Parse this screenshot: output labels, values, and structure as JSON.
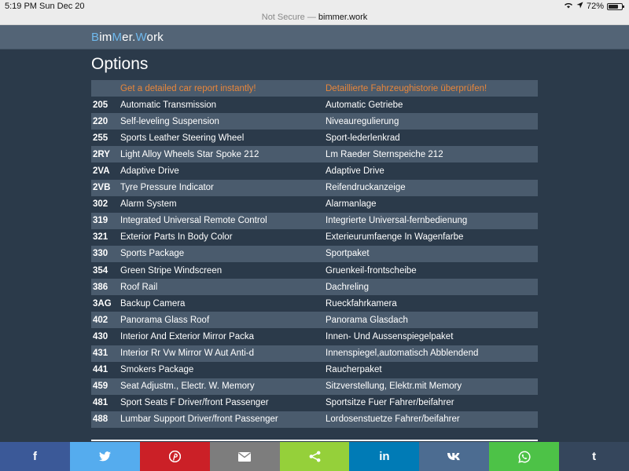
{
  "status_bar": {
    "time": "5:19 PM",
    "date": "Sun Dec 20",
    "battery": "72%",
    "battery_level": 0.72
  },
  "browser": {
    "security": "Not Secure —",
    "domain": "bimmer.work"
  },
  "site": {
    "logo_parts": [
      "B",
      "im",
      "M",
      "er.",
      "W",
      "ork"
    ]
  },
  "page": {
    "title": "Options"
  },
  "table": {
    "header": {
      "code": "",
      "en": "Get a detailed car report instantly!",
      "de": "Detaillierte Fahrzeughistorie überprüfen!"
    },
    "rows": [
      {
        "code": "205",
        "en": "Automatic Transmission",
        "de": "Automatic Getriebe"
      },
      {
        "code": "220",
        "en": "Self-leveling Suspension",
        "de": "Niveauregulierung"
      },
      {
        "code": "255",
        "en": "Sports Leather Steering Wheel",
        "de": "Sport-lederlenkrad"
      },
      {
        "code": "2RY",
        "en": "Light Alloy Wheels Star Spoke 212",
        "de": "Lm Raeder Sternspeiche 212"
      },
      {
        "code": "2VA",
        "en": "Adaptive Drive",
        "de": "Adaptive Drive"
      },
      {
        "code": "2VB",
        "en": "Tyre Pressure Indicator",
        "de": "Reifendruckanzeige"
      },
      {
        "code": "302",
        "en": "Alarm System",
        "de": "Alarmanlage"
      },
      {
        "code": "319",
        "en": "Integrated Universal Remote Control",
        "de": "Integrierte Universal-fernbedienung"
      },
      {
        "code": "321",
        "en": "Exterior Parts In Body Color",
        "de": "Exterieurumfaenge In Wagenfarbe"
      },
      {
        "code": "330",
        "en": "Sports Package",
        "de": "Sportpaket"
      },
      {
        "code": "354",
        "en": "Green Stripe Windscreen",
        "de": "Gruenkeil-frontscheibe"
      },
      {
        "code": "386",
        "en": "Roof Rail",
        "de": "Dachreling"
      },
      {
        "code": "3AG",
        "en": "Backup Camera",
        "de": "Rueckfahrkamera"
      },
      {
        "code": "402",
        "en": "Panorama Glass Roof",
        "de": "Panorama Glasdach"
      },
      {
        "code": "430",
        "en": "Interior And Exterior Mirror Packa",
        "de": "Innen- Und Aussenspiegelpaket"
      },
      {
        "code": "431",
        "en": "Interior Rr Vw Mirror W Aut Anti-d",
        "de": "Innenspiegel,automatisch Abblendend"
      },
      {
        "code": "441",
        "en": "Smokers Package",
        "de": "Raucherpaket"
      },
      {
        "code": "459",
        "en": "Seat Adjustm., Electr. W. Memory",
        "de": "Sitzverstellung, Elektr.mit Memory"
      },
      {
        "code": "481",
        "en": "Sport Seats F Driver/front Passenger",
        "de": "Sportsitze Fuer Fahrer/beifahrer"
      },
      {
        "code": "488",
        "en": "Lumbar Support Driver/front Passenger",
        "de": "Lordosenstuetze Fahrer/beifahrer"
      }
    ]
  },
  "share_bar": [
    {
      "name": "facebook",
      "icon": "facebook-icon",
      "glyph": "f",
      "color": "#3b5998"
    },
    {
      "name": "twitter",
      "icon": "twitter-icon",
      "glyph": "",
      "color": "#55acee"
    },
    {
      "name": "pinterest",
      "icon": "pinterest-icon",
      "glyph": "",
      "color": "#cb2027"
    },
    {
      "name": "email",
      "icon": "email-icon",
      "glyph": "",
      "color": "#7d7d7d"
    },
    {
      "name": "share",
      "icon": "share-icon",
      "glyph": "",
      "color": "#95d03a"
    },
    {
      "name": "linkedin",
      "icon": "linkedin-icon",
      "glyph": "in",
      "color": "#007bb6"
    },
    {
      "name": "vk",
      "icon": "vk-icon",
      "glyph": "",
      "color": "#4c6c91"
    },
    {
      "name": "whatsapp",
      "icon": "whatsapp-icon",
      "glyph": "",
      "color": "#4dc247"
    },
    {
      "name": "tumblr",
      "icon": "tumblr-icon",
      "glyph": "t",
      "color": "#35465c"
    }
  ],
  "colors": {
    "background": "#2b3a4a",
    "row_stripe": "#4a5b6d",
    "header_text": "#e8863a",
    "logo_accent": "#6fb8ec"
  }
}
